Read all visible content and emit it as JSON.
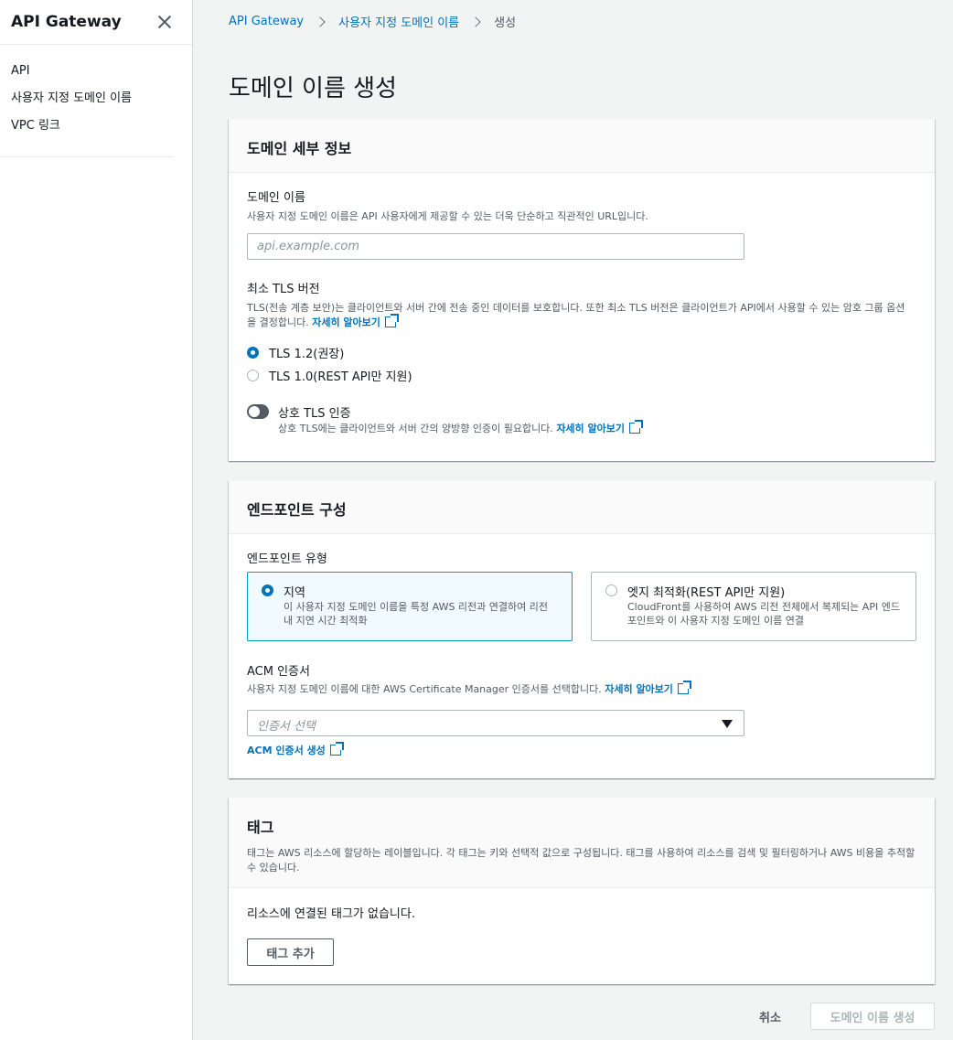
{
  "sidebar": {
    "title": "API Gateway",
    "items": [
      {
        "label": "API"
      },
      {
        "label": "사용자 지정 도메인 이름"
      },
      {
        "label": "VPC 링크"
      }
    ]
  },
  "breadcrumb": {
    "items": [
      "API Gateway",
      "사용자 지정 도메인 이름"
    ],
    "current": "생성"
  },
  "page": {
    "title": "도메인 이름 생성"
  },
  "domain_details": {
    "header": "도메인 세부 정보",
    "domain_name_label": "도메인 이름",
    "domain_name_desc": "사용자 지정 도메인 이름은 API 사용자에게 제공할 수 있는 더욱 단순하고 직관적인 URL입니다.",
    "domain_name_placeholder": "api.example.com",
    "domain_name_value": "",
    "tls_label": "최소 TLS 버전",
    "tls_desc_line1": "TLS(전송 계층 보안)는 클라이언트와 서버 간에 전송 중인 데이터를 보호합니다. 또한 최소 TLS 버전은 클라이언트가 API에서 사용할 수 있는 암호 그룹 옵션",
    "tls_desc_line2": "을 결정합니다.",
    "learn_more": "자세히 알아보기",
    "tls_options": [
      {
        "label": "TLS 1.2(권장)",
        "selected": true
      },
      {
        "label": "TLS 1.0(REST API만 지원)",
        "selected": false
      }
    ],
    "mtls_label": "상호 TLS 인증",
    "mtls_enabled": false,
    "mtls_desc": "상호 TLS에는 클라이언트와 서버 간의 양방향 인증이 필요합니다."
  },
  "endpoint": {
    "header": "엔드포인트 구성",
    "type_label": "엔드포인트 유형",
    "tiles": [
      {
        "title": "지역",
        "desc": "이 사용자 지정 도메인 이름을 특정 AWS 리전과 연결하여 리전 내 지연 시간 최적화",
        "selected": true
      },
      {
        "title": "엣지 최적화(REST API만 지원)",
        "desc": "CloudFront를 사용하여 AWS 리전 전체에서 복제되는 API 엔드포인트와 이 사용자 지정 도메인 이름 연결",
        "selected": false
      }
    ],
    "acm_label": "ACM 인증서",
    "acm_desc": "사용자 지정 도메인 이름에 대한 AWS Certificate Manager 인증서를 선택합니다.",
    "acm_placeholder": "인증서 선택",
    "acm_create": "ACM 인증서 생성"
  },
  "tags": {
    "header": "태그",
    "desc": "태그는 AWS 리소스에 할당하는 레이블입니다. 각 태그는 키와 선택적 값으로 구성됩니다. 태그를 사용하여 리소스를 검색 및 필터링하거나 AWS 비용을 추적할 수 있습니다.",
    "empty": "리소스에 연결된 태그가 없습니다.",
    "add_button": "태그 추가"
  },
  "footer": {
    "cancel": "취소",
    "submit": "도메인 이름 생성"
  }
}
